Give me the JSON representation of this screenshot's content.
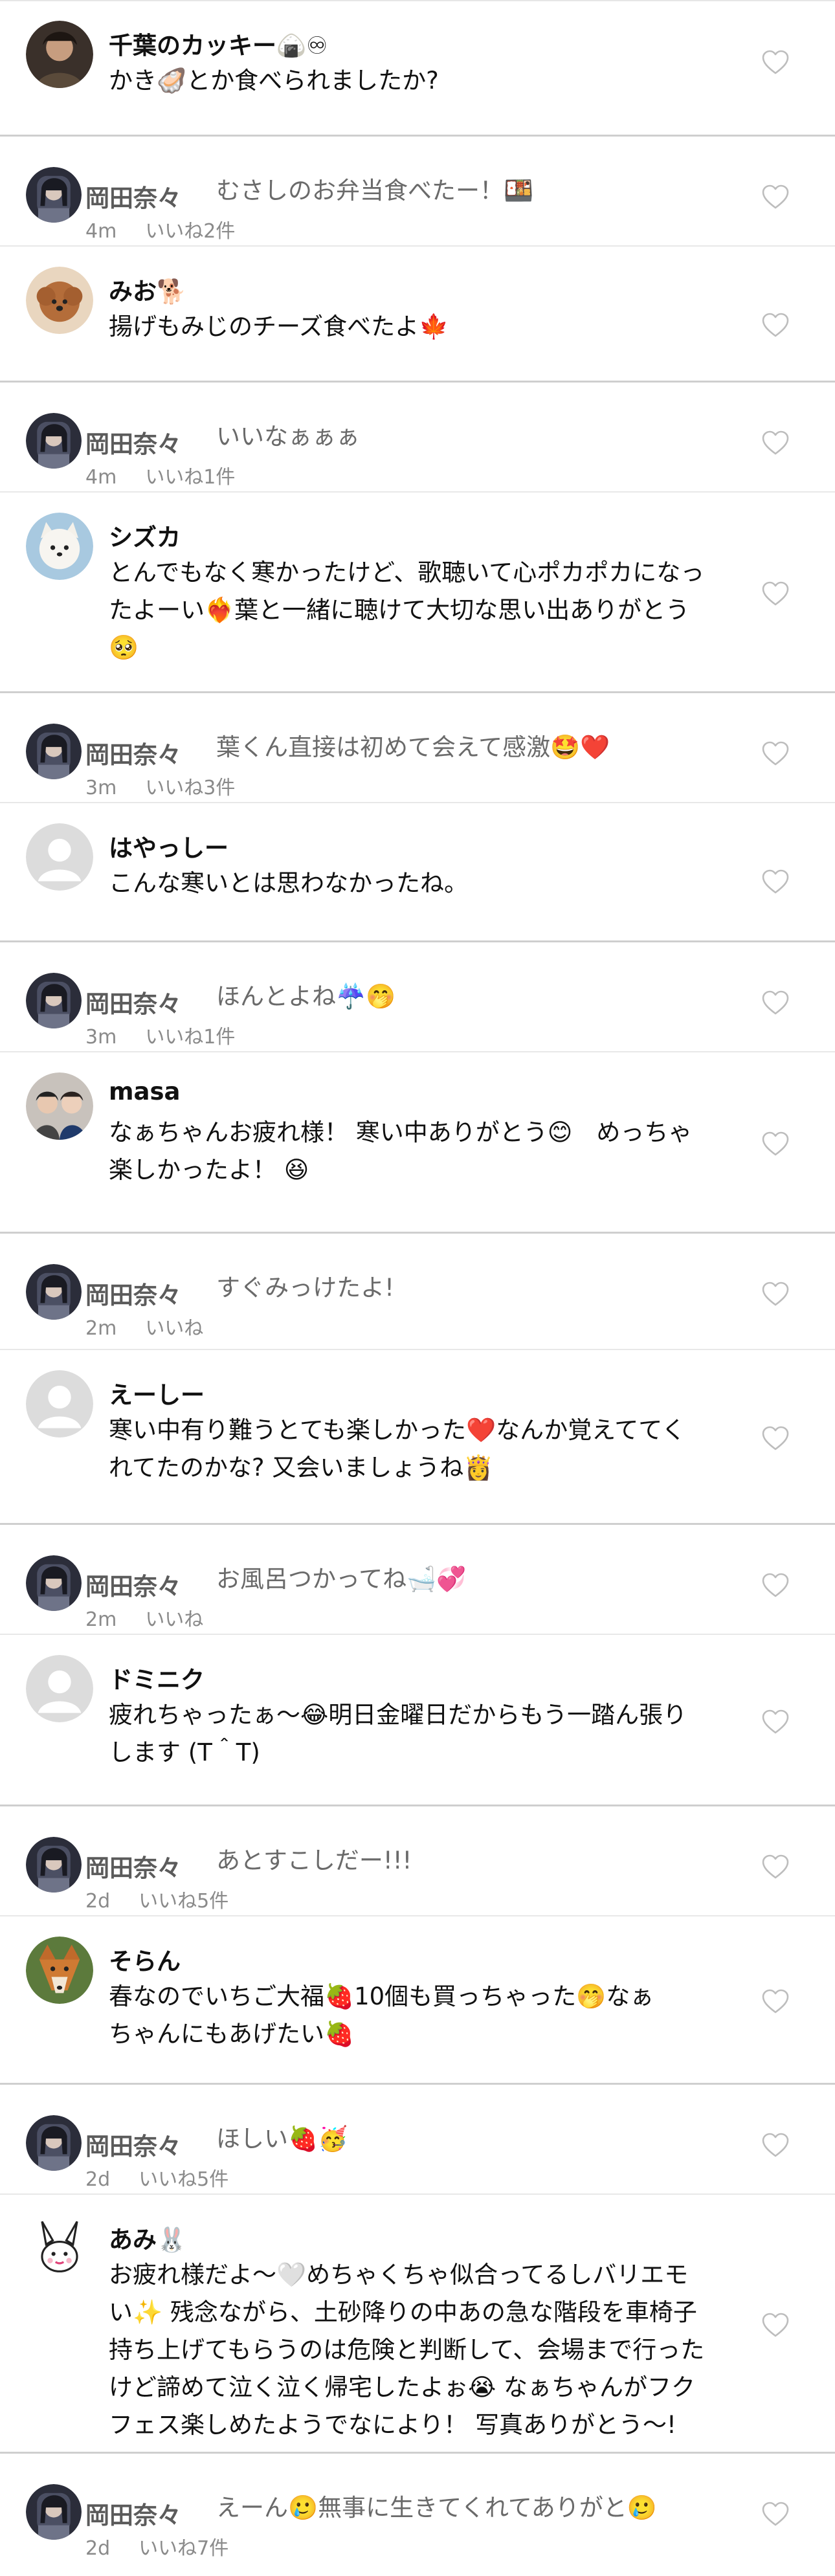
{
  "colors": {
    "separator": "#cfcfcf",
    "reply_name": "#5b5b5b",
    "muted_text": "#6a6a6a",
    "meta_text": "#8a8a8a",
    "heart_outline": "#bdbdbd"
  },
  "icons": {
    "like": "heart-outline-icon",
    "default_avatar": "person-silhouette-icon"
  },
  "comments": [
    {
      "name": "千葉のカッキー🍙♾",
      "text_lines": [
        "かき🦪とか食べられましたか?"
      ]
    },
    {
      "name": "岡田奈々",
      "text_lines": [
        "むさしのお弁当食べたー！🍱"
      ],
      "time": "4m",
      "likes": "いいね2件"
    },
    {
      "name": "みお🐕",
      "text_lines": [
        "揚げもみじのチーズ食べたよ🍁"
      ]
    },
    {
      "name": "岡田奈々",
      "text_lines": [
        "いいなぁぁぁ"
      ],
      "time": "4m",
      "likes": "いいね1件"
    },
    {
      "name": "シズカ",
      "text_lines": [
        "とんでもなく寒かったけど、歌聴いて心ポカポカになっ",
        "たよーい❤️‍🔥葉と一緒に聴けて大切な思い出ありがとう",
        "🥺"
      ]
    },
    {
      "name": "岡田奈々",
      "text_lines": [
        "葉くん直接は初めて会えて感激🤩❤️"
      ],
      "time": "3m",
      "likes": "いいね3件"
    },
    {
      "name": "はやっしー",
      "text_lines": [
        "こんな寒いとは思わなかったね。"
      ]
    },
    {
      "name": "岡田奈々",
      "text_lines": [
        "ほんとよね☔️🤭"
      ],
      "time": "3m",
      "likes": "いいね1件"
    },
    {
      "name": "masa",
      "text_lines": [
        "なぁちゃんお疲れ様！ 寒い中ありがとう😊　めっちゃ",
        "楽しかったよ！ 😆"
      ]
    },
    {
      "name": "岡田奈々",
      "text_lines": [
        "すぐみっけたよ!"
      ],
      "time": "2m",
      "likes": "いいね"
    },
    {
      "name": "えーしー",
      "text_lines": [
        "寒い中有り難うとても楽しかった❤️なんか覚えててく",
        "れてたのかな? 又会いましょうね👸"
      ]
    },
    {
      "name": "岡田奈々",
      "text_lines": [
        "お風呂つかってね🛁💞"
      ],
      "time": "2m",
      "likes": "いいね"
    },
    {
      "name": "ドミニク",
      "text_lines": [
        "疲れちゃったぁ～😂明日金曜日だからもう一踏ん張り",
        "します (T＾T)"
      ]
    },
    {
      "name": "岡田奈々",
      "text_lines": [
        "あとすこしだー!!!"
      ],
      "time": "2d",
      "likes": "いいね5件"
    },
    {
      "name": "そらん",
      "text_lines": [
        "春なのでいちご大福🍓10個も買っちゃった🤭なぁ",
        "ちゃんにもあげたい🍓"
      ]
    },
    {
      "name": "岡田奈々",
      "text_lines": [
        "ほしい🍓🥳"
      ],
      "time": "2d",
      "likes": "いいね5件"
    },
    {
      "name": "あみ🐰",
      "text_lines": [
        "お疲れ様だよ～🤍めちゃくちゃ似合ってるしバリエモ",
        "い✨ 残念ながら、土砂降りの中あの急な階段を車椅子",
        "持ち上げてもらうのは危険と判断して、会場まで行った",
        "けど諦めて泣く泣く帰宅したよぉ😭 なぁちゃんがフク",
        "フェス楽しめたようでなにより！ 写真ありがとう～!"
      ]
    },
    {
      "name": "岡田奈々",
      "text_lines": [
        "えーん🥲無事に生きてくれてありがと🥲"
      ],
      "time": "2d",
      "likes": "いいね7件"
    }
  ]
}
